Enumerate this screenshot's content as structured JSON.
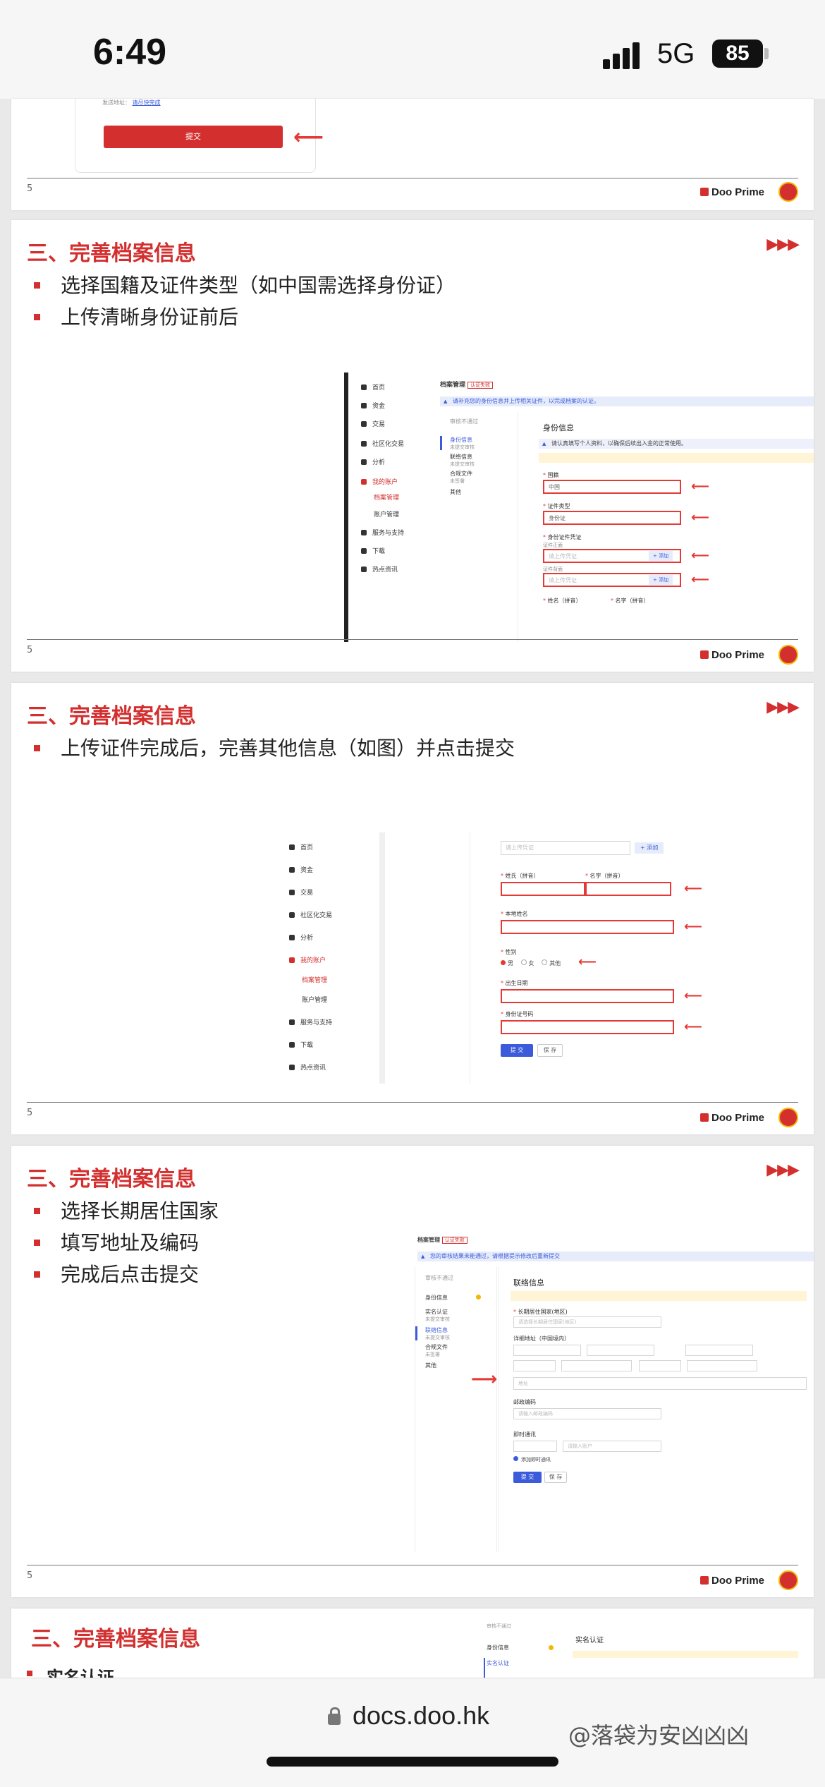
{
  "status": {
    "time": "6:49",
    "network": "5G",
    "battery": "85"
  },
  "top_snippet": {
    "link": "请尽快完成",
    "label": "发送地址：",
    "submit": "提交"
  },
  "common": {
    "page_num": "5",
    "brand": "Doo Prime",
    "arrows": "▶▶▶",
    "title": "三、完善档案信息"
  },
  "slide1": {
    "bullets": [
      "选择国籍及证件类型（如中国需选择身份证）",
      "上传清晰身份证前后"
    ],
    "sidebar": [
      "首页",
      "资金",
      "交易",
      "社区化交易",
      "分析",
      "我的账户",
      "档案管理",
      "账户管理",
      "服务与支持",
      "下载",
      "热点资讯"
    ],
    "header": "档案管理",
    "header_badge": "认证失败",
    "banner": "请补充您的身份信息并上传相关证件，以完成档案的认证。",
    "menu": [
      {
        "t": "身份信息",
        "s": "未提交审核"
      },
      {
        "t": "联络信息",
        "s": "未提交审核"
      },
      {
        "t": "合规文件",
        "s": "未签署"
      },
      {
        "t": "其他",
        "s": ""
      }
    ],
    "menu_head": "审核不通过",
    "section": "身份信息",
    "info": "请认真填写个人资料，以确保后续出入金的正常使用。",
    "labels": [
      "国籍",
      "证件类型",
      "身份证件凭证",
      "证件正面",
      "证件背面",
      "姓名（拼音）",
      "名字（拼音）"
    ],
    "values": [
      "中国",
      "身份证",
      "请上传凭证",
      "请上传凭证"
    ],
    "add": "+ 添加"
  },
  "slide2": {
    "bullets": [
      "上传证件完成后，完善其他信息（如图）并点击提交"
    ],
    "sidebar": [
      "首页",
      "资金",
      "交易",
      "社区化交易",
      "分析",
      "我的账户",
      "档案管理",
      "账户管理",
      "服务与支持",
      "下载",
      "热点资讯"
    ],
    "upload_placeholder": "请上传凭证",
    "add": "+ 添加",
    "labels": [
      "姓氏（拼音）",
      "名字（拼音）",
      "本地姓名",
      "性别",
      "出生日期",
      "身份证号码"
    ],
    "genders": [
      "男",
      "女",
      "其他"
    ],
    "submit": "提 交",
    "save": "保 存"
  },
  "slide3": {
    "bullets": [
      "选择长期居住国家",
      "填写地址及编码",
      "完成后点击提交"
    ],
    "header": "档案管理",
    "header_badge": "认证失败",
    "banner": "您的审核结果未能通过，请根据提示修改后重新提交",
    "menu_head": "审核不通过",
    "menu": [
      {
        "t": "身份信息",
        "s": ""
      },
      {
        "t": "实名认证",
        "s": "未提交审核"
      },
      {
        "t": "联络信息",
        "s": "未提交审核"
      },
      {
        "t": "合规文件",
        "s": "未签署"
      },
      {
        "t": "其他",
        "s": ""
      }
    ],
    "section": "联络信息",
    "labels": [
      "长期居住国家(地区)",
      "详细地址（中国境内）",
      "邮政编码",
      "即时通讯"
    ],
    "placeholders": [
      "请选择长期居住国家(地区)",
      "地址",
      "请输入邮政编码",
      "请输入账户"
    ],
    "checkbox": "添加即时通讯",
    "submit": "提 交",
    "save": "保 存"
  },
  "slide4": {
    "bullets": [
      "实名认证"
    ],
    "menu_head": "审核不通过",
    "menu": [
      "身份信息",
      "实名认证"
    ],
    "section": "实名认证"
  },
  "browser": {
    "url": "docs.doo.hk",
    "watermark": "@落袋为安凶凶凶"
  }
}
